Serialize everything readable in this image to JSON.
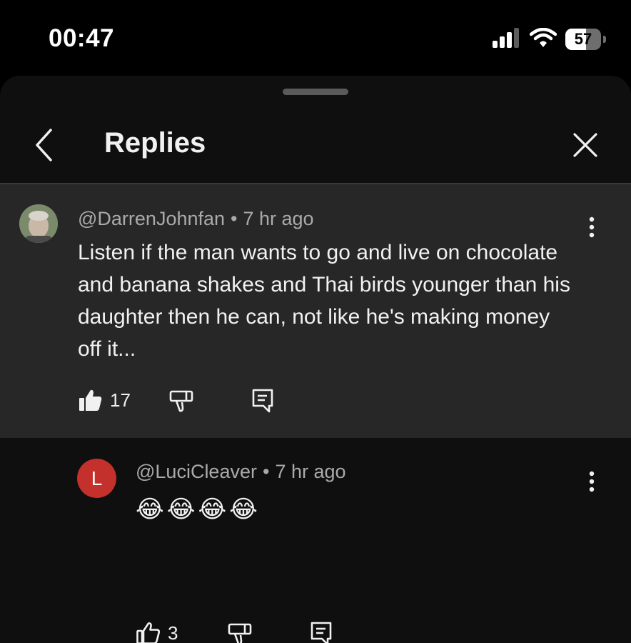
{
  "status": {
    "time": "00:47",
    "battery": "57",
    "battery_level": 0.57
  },
  "header": {
    "title": "Replies"
  },
  "parent": {
    "author": "@DarrenJohnfan",
    "separator": "•",
    "time": "7 hr ago",
    "text": "Listen if the man wants to go and live on chocolate and banana shakes and Thai birds younger than his daughter then he can, not like he's making money off it...",
    "likes": "17"
  },
  "reply": {
    "avatar_letter": "L",
    "author": "@LuciCleaver",
    "separator": "•",
    "time": "7 hr ago",
    "text": "😂😂😂😂",
    "likes": "3"
  },
  "colors": {
    "sheet": "#0f0f0f",
    "highlight": "#272727",
    "avatar_red": "#c4302b",
    "muted": "#aaaaaa"
  },
  "icons": [
    "signal-icon",
    "wifi-icon",
    "battery-icon",
    "back-arrow-icon",
    "close-icon",
    "more-vert-icon",
    "like-icon",
    "dislike-icon",
    "reply-icon"
  ]
}
